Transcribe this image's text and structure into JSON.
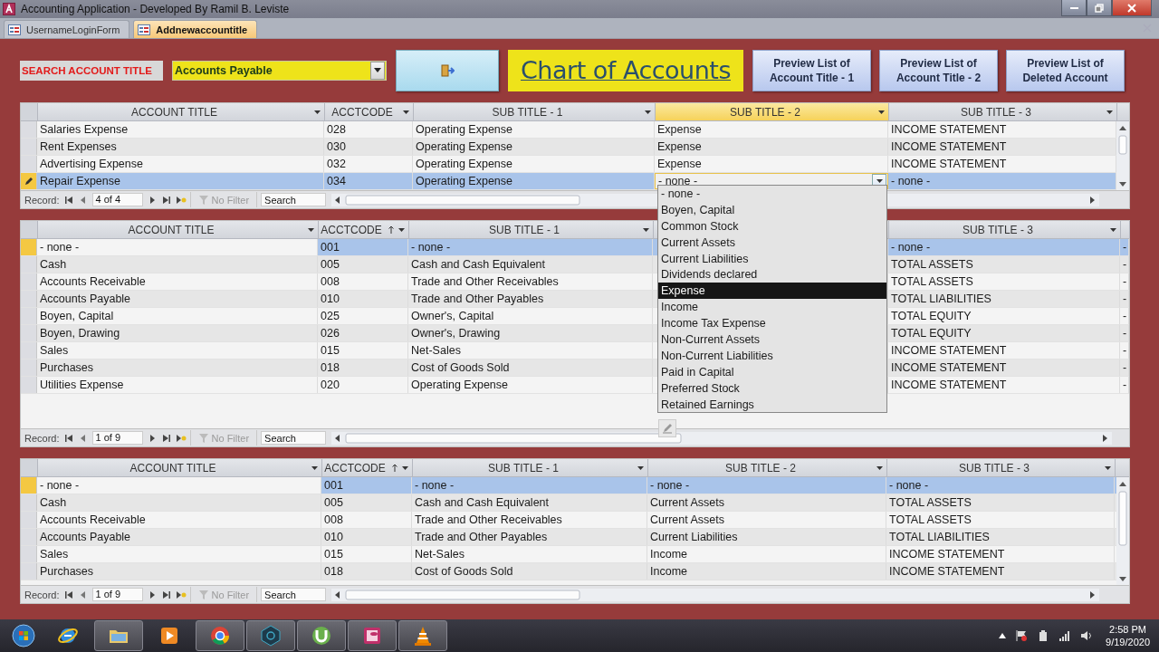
{
  "window": {
    "title": "Accounting Application - Developed By Ramil B. Leviste"
  },
  "tabs": [
    {
      "label": "UsernameLoginForm",
      "selected": false
    },
    {
      "label": "Addnewaccountitle",
      "selected": true
    }
  ],
  "search": {
    "label": "SEARCH ACCOUNT TITLE",
    "value": "Accounts Payable"
  },
  "form_title": "Chart of Accounts",
  "buttons": [
    "Preview List of Account Title - 1",
    "Preview List of Account Title - 2",
    "Preview List of Deleted Account"
  ],
  "grids": [
    {
      "columns": [
        {
          "label": "ACCOUNT TITLE",
          "sorted": false,
          "active": false
        },
        {
          "label": "ACCTCODE",
          "sorted": false,
          "active": false
        },
        {
          "label": "SUB TITLE - 1",
          "sorted": false,
          "active": false
        },
        {
          "label": "SUB TITLE - 2",
          "sorted": false,
          "active": true
        },
        {
          "label": "SUB TITLE - 3",
          "sorted": false,
          "active": false
        }
      ],
      "rows": [
        {
          "selected": false,
          "editing": false,
          "cells": [
            "Salaries Expense",
            "028",
            "Operating Expense",
            "Expense",
            "INCOME STATEMENT"
          ]
        },
        {
          "selected": false,
          "editing": false,
          "cells": [
            "Rent Expenses",
            "030",
            "Operating Expense",
            "Expense",
            "INCOME STATEMENT"
          ]
        },
        {
          "selected": false,
          "editing": false,
          "cells": [
            "Advertising Expense",
            "032",
            "Operating Expense",
            "Expense",
            "INCOME STATEMENT"
          ]
        },
        {
          "selected": true,
          "editing": true,
          "cells": [
            "Repair Expense",
            "034",
            "Operating Expense",
            {
              "text": "- none -",
              "kind": "combo"
            },
            "- none -"
          ]
        }
      ],
      "record_label": "Record:",
      "record": "4 of 4",
      "filter": "No Filter",
      "search_placeholder": "Search"
    },
    {
      "columns": [
        {
          "label": "ACCOUNT TITLE",
          "sorted": false,
          "active": false
        },
        {
          "label": "ACCTCODE",
          "sorted": true,
          "active": false
        },
        {
          "label": "SUB TITLE - 1",
          "sorted": false,
          "active": false
        },
        {
          "label": "SUB TITLE - 3",
          "sorted": false,
          "active": false
        },
        {
          "sorted": false,
          "active": false
        }
      ],
      "rows": [
        {
          "selected": true,
          "editing": false,
          "cells": [
            {
              "text": "- none -",
              "kind": "focus"
            },
            "001",
            "- none -",
            "- none -",
            "-"
          ]
        },
        {
          "selected": false,
          "editing": false,
          "cells": [
            "Cash",
            "005",
            "Cash and  Cash Equivalent",
            "TOTAL ASSETS",
            "-"
          ]
        },
        {
          "selected": false,
          "editing": false,
          "cells": [
            "Accounts Receivable",
            "008",
            "Trade and Other Receivables",
            "TOTAL ASSETS",
            "-"
          ]
        },
        {
          "selected": false,
          "editing": false,
          "cells": [
            "Accounts Payable",
            "010",
            "Trade and Other Payables",
            "TOTAL LIABILITIES",
            "-"
          ]
        },
        {
          "selected": false,
          "editing": false,
          "cells": [
            "Boyen, Capital",
            "025",
            "Owner's, Capital",
            "TOTAL EQUITY",
            "-"
          ]
        },
        {
          "selected": false,
          "editing": false,
          "cells": [
            "Boyen, Drawing",
            "026",
            "Owner's, Drawing",
            "TOTAL EQUITY",
            "-"
          ]
        },
        {
          "selected": false,
          "editing": false,
          "cells": [
            "Sales",
            "015",
            "Net-Sales",
            "INCOME STATEMENT",
            "-"
          ]
        },
        {
          "selected": false,
          "editing": false,
          "cells": [
            "Purchases",
            "018",
            "Cost of Goods Sold",
            "INCOME STATEMENT",
            "-"
          ]
        },
        {
          "selected": false,
          "editing": false,
          "cells": [
            "Utilities Expense",
            "020",
            "Operating Expense",
            "INCOME STATEMENT",
            "-"
          ]
        }
      ],
      "record_label": "Record:",
      "record": "1 of 9",
      "filter": "No Filter",
      "search_placeholder": "Search"
    },
    {
      "columns": [
        {
          "label": "ACCOUNT TITLE",
          "sorted": false,
          "active": false
        },
        {
          "label": "ACCTCODE",
          "sorted": true,
          "active": false
        },
        {
          "label": "SUB TITLE - 1",
          "sorted": false,
          "active": false
        },
        {
          "label": "SUB TITLE - 2",
          "sorted": false,
          "active": false
        },
        {
          "label": "SUB TITLE - 3",
          "sorted": false,
          "active": false
        }
      ],
      "rows": [
        {
          "selected": true,
          "editing": false,
          "cells": [
            {
              "text": "- none -",
              "kind": "focus"
            },
            "001",
            "- none -",
            "- none -",
            "- none -"
          ]
        },
        {
          "selected": false,
          "editing": false,
          "cells": [
            "Cash",
            "005",
            "Cash and  Cash Equivalent",
            "Current Assets",
            "TOTAL ASSETS"
          ]
        },
        {
          "selected": false,
          "editing": false,
          "cells": [
            "Accounts Receivable",
            "008",
            "Trade and Other Receivables",
            "Current Assets",
            "TOTAL ASSETS"
          ]
        },
        {
          "selected": false,
          "editing": false,
          "cells": [
            "Accounts Payable",
            "010",
            "Trade and Other Payables",
            "Current Liabilities",
            "TOTAL LIABILITIES"
          ]
        },
        {
          "selected": false,
          "editing": false,
          "cells": [
            "Sales",
            "015",
            "Net-Sales",
            "Income",
            "INCOME STATEMENT"
          ]
        },
        {
          "selected": false,
          "editing": false,
          "cells": [
            "Purchases",
            "018",
            "Cost of Goods Sold",
            "Income",
            "INCOME STATEMENT"
          ]
        }
      ],
      "record_label": "Record:",
      "record": "1 of 9",
      "filter": "No Filter",
      "search_placeholder": "Search"
    }
  ],
  "dropdown": {
    "items": [
      {
        "label": "- none -",
        "selected": false
      },
      {
        "label": "Boyen, Capital",
        "selected": false
      },
      {
        "label": "Common Stock",
        "selected": false
      },
      {
        "label": "Current Assets",
        "selected": false
      },
      {
        "label": "Current Liabilities",
        "selected": false
      },
      {
        "label": "Dividends declared",
        "selected": false
      },
      {
        "label": "Expense",
        "selected": true
      },
      {
        "label": "Income",
        "selected": false
      },
      {
        "label": "Income Tax Expense",
        "selected": false
      },
      {
        "label": "Non-Current Assets",
        "selected": false
      },
      {
        "label": "Non-Current Liabilities",
        "selected": false
      },
      {
        "label": "Paid in Capital",
        "selected": false
      },
      {
        "label": "Preferred Stock",
        "selected": false
      },
      {
        "label": "Retained Earnings",
        "selected": false
      }
    ]
  },
  "taskbar": {
    "apps": [
      {
        "kind": "ie",
        "running": false
      },
      {
        "kind": "folder",
        "running": true
      },
      {
        "kind": "media",
        "running": false
      },
      {
        "kind": "chrome",
        "running": true
      },
      {
        "kind": "nox",
        "running": true
      },
      {
        "kind": "torrent",
        "running": true
      },
      {
        "kind": "access",
        "running": true
      },
      {
        "kind": "vlc",
        "running": true
      }
    ],
    "time": "2:58 PM",
    "date": "9/19/2020"
  }
}
